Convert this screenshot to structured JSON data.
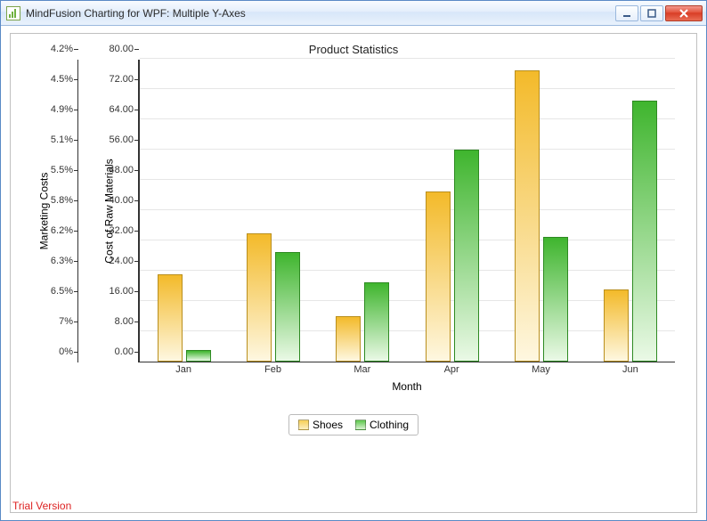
{
  "window": {
    "title": "MindFusion Charting for WPF: Multiple Y-Axes"
  },
  "chart_data": {
    "type": "bar",
    "title": "Product Statistics",
    "categories": [
      "Jan",
      "Feb",
      "Mar",
      "Apr",
      "May",
      "Jun"
    ],
    "series": [
      {
        "name": "Shoes",
        "values": [
          23,
          34,
          12,
          45,
          77,
          19
        ]
      },
      {
        "name": "Clothing",
        "values": [
          3,
          29,
          21,
          56,
          33,
          69
        ]
      }
    ],
    "xlabel": "Month",
    "y_axis_primary": {
      "label": "Cost of Raw Materials",
      "ticks": [
        "0.00",
        "8.00",
        "16.00",
        "24.00",
        "32.00",
        "40.00",
        "48.00",
        "56.00",
        "64.00",
        "72.00",
        "80.00"
      ],
      "range": [
        0,
        80
      ]
    },
    "y_axis_secondary": {
      "label": "Marketing Costs",
      "ticks": [
        "0%",
        "7%",
        "6.5%",
        "6.3%",
        "6.2%",
        "5.8%",
        "5.5%",
        "5.1%",
        "4.9%",
        "4.5%",
        "4.2%"
      ]
    },
    "legend": [
      "Shoes",
      "Clothing"
    ],
    "colors": {
      "Shoes": "#f3ba2a",
      "Clothing": "#3fb52e"
    }
  },
  "footer": {
    "trial": "Trial Version"
  }
}
